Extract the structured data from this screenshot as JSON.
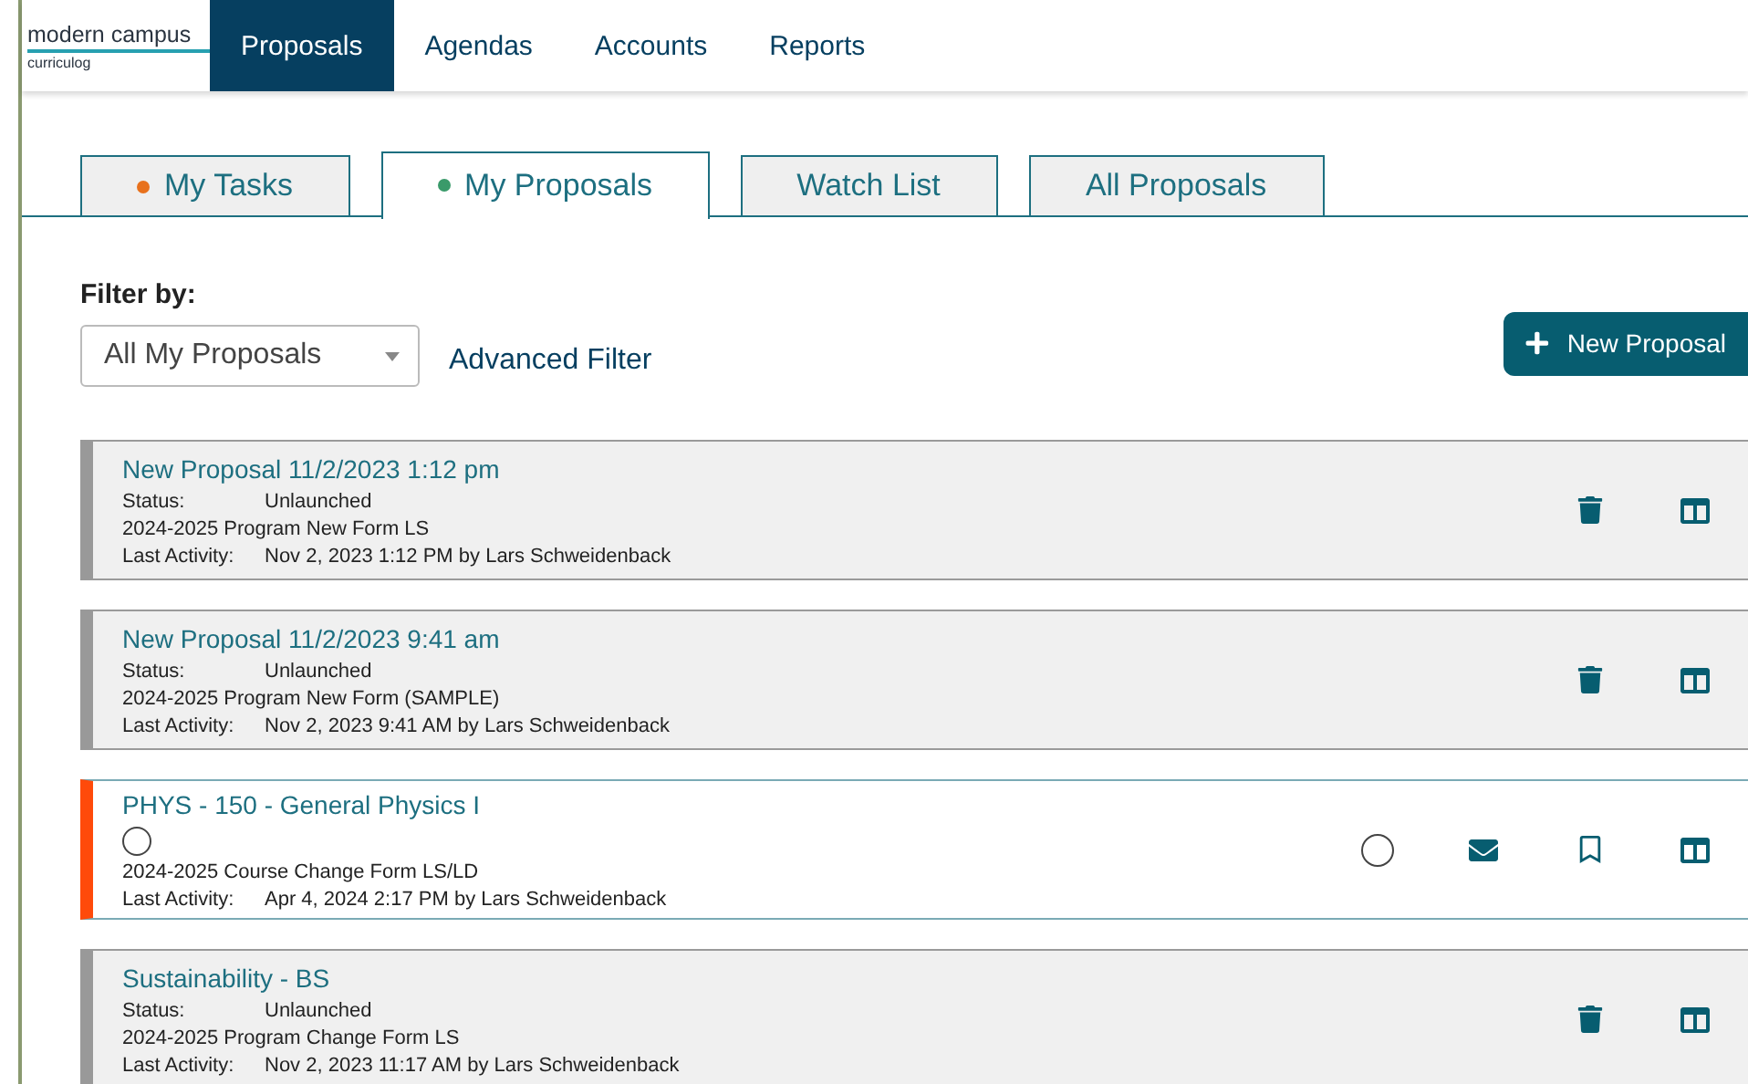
{
  "logo": {
    "name": "modern campus",
    "product": "curriculog"
  },
  "nav": [
    {
      "label": "Proposals",
      "selected": true
    },
    {
      "label": "Agendas",
      "selected": false
    },
    {
      "label": "Accounts",
      "selected": false
    },
    {
      "label": "Reports",
      "selected": false
    }
  ],
  "tabs": [
    {
      "label": "My Tasks",
      "selected": false,
      "color": "#e8711c"
    },
    {
      "label": "My Proposals",
      "selected": true,
      "color": "#3a9a6a"
    },
    {
      "label": "Watch List",
      "selected": false
    },
    {
      "label": "All Proposals",
      "selected": false
    }
  ],
  "filter": {
    "label": "Filter by:",
    "value": "All My Proposals",
    "advanced": "Advanced Filter"
  },
  "new_button": "New Proposal",
  "proposals": [
    {
      "kind": "draft",
      "title": "New Proposal 11/2/2023 1:12 pm",
      "status_label": "Status:",
      "status": "Unlaunched",
      "form": "2024-2025 Program New Form LS",
      "activity_label": "Last Activity:",
      "activity": "Nov 2, 2023 1:12 PM by Lars Schweidenback",
      "actions": [
        {
          "kind": "delete"
        },
        {
          "kind": "columns"
        }
      ]
    },
    {
      "kind": "draft",
      "title": "New Proposal 11/2/2023 9:41 am",
      "status_label": "Status:",
      "status": "Unlaunched",
      "form": "2024-2025 Program New Form (SAMPLE)",
      "activity_label": "Last Activity:",
      "activity": "Nov 2, 2023 9:41 AM by Lars Schweidenback",
      "actions": [
        {
          "kind": "delete"
        },
        {
          "kind": "columns"
        }
      ]
    },
    {
      "kind": "launched",
      "title": "PHYS - 150 - General Physics I",
      "form": "2024-2025 Course Change Form LS/LD",
      "activity_label": "Last Activity:",
      "activity": "Apr 4, 2024 2:17 PM by Lars Schweidenback",
      "actions": [
        {
          "kind": "circle"
        },
        {
          "kind": "mail"
        },
        {
          "kind": "bookmark"
        },
        {
          "kind": "columns"
        }
      ]
    },
    {
      "kind": "draft",
      "title": "Sustainability - BS",
      "status_label": "Status:",
      "status": "Unlaunched",
      "form": "2024-2025 Program Change Form LS",
      "activity_label": "Last Activity:",
      "activity": "Nov 2, 2023 11:17 AM by Lars Schweidenback",
      "actions": [
        {
          "kind": "delete"
        },
        {
          "kind": "columns"
        }
      ]
    }
  ]
}
